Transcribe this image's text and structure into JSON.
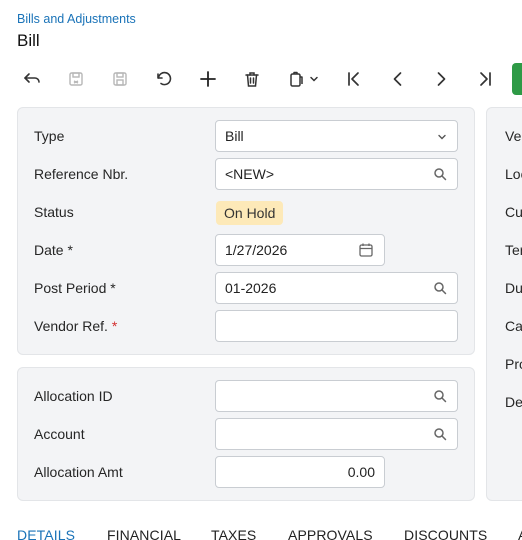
{
  "header": {
    "breadcrumb": "Bills and Adjustments",
    "title": "Bill"
  },
  "toolbar": {
    "buttons": [
      {
        "name": "back",
        "icon": "back-arrow-icon"
      },
      {
        "name": "save-and-close",
        "icon": "save-close-icon"
      },
      {
        "name": "save",
        "icon": "save-icon"
      },
      {
        "name": "undo",
        "icon": "undo-icon"
      },
      {
        "name": "add",
        "icon": "plus-icon"
      },
      {
        "name": "delete",
        "icon": "trash-icon"
      },
      {
        "name": "copy-paste",
        "icon": "clipboard-icon"
      },
      {
        "name": "first",
        "icon": "first-record-icon"
      },
      {
        "name": "previous",
        "icon": "previous-record-icon"
      },
      {
        "name": "next",
        "icon": "next-record-icon"
      },
      {
        "name": "last",
        "icon": "last-record-icon"
      }
    ],
    "primary_color": "#2e9a46"
  },
  "summary": {
    "type_label": "Type",
    "type_value": "Bill",
    "reference_label": "Reference Nbr.",
    "reference_value": "<NEW>",
    "status_label": "Status",
    "status_value": "On Hold",
    "date_label": "Date",
    "date_value": "1/27/2026",
    "post_period_label": "Post Period",
    "post_period_value": "01-2026",
    "vendor_ref_label": "Vendor Ref.",
    "vendor_ref_value": "",
    "required_mark": "*"
  },
  "allocation": {
    "allocation_id_label": "Allocation ID",
    "allocation_id_value": "",
    "account_label": "Account",
    "account_value": "",
    "allocation_amt_label": "Allocation Amt",
    "allocation_amt_value": "0.00"
  },
  "right_panel": {
    "labels": [
      "Ver",
      "Loc",
      "Cur",
      "Ter",
      "Du",
      "Ca",
      "Pro",
      "De"
    ]
  },
  "tabs": [
    {
      "label": "DETAILS",
      "active": true
    },
    {
      "label": "FINANCIAL",
      "active": false
    },
    {
      "label": "TAXES",
      "active": false
    },
    {
      "label": "APPROVALS",
      "active": false
    },
    {
      "label": "DISCOUNTS",
      "active": false
    },
    {
      "label": "A",
      "active": false
    }
  ],
  "colors": {
    "accent": "#1a73b8",
    "status_badge": "#fde9b8",
    "required": "#d32f2f"
  }
}
